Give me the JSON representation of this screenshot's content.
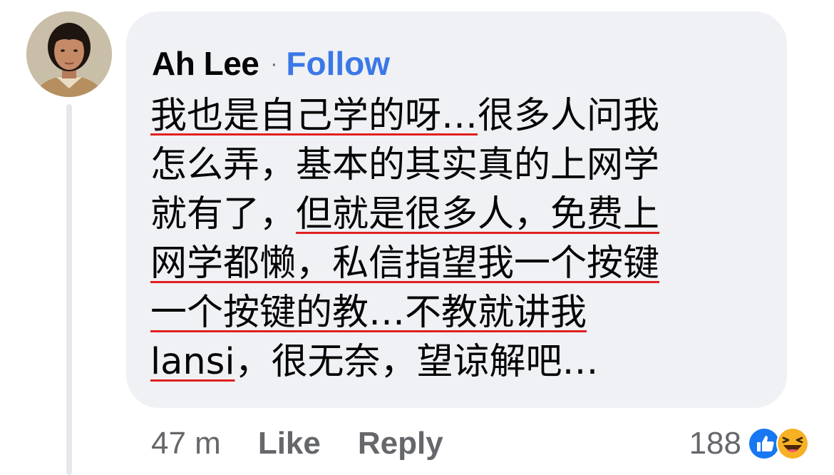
{
  "author": {
    "name": "Ah Lee",
    "separator": "·",
    "follow_label": "Follow"
  },
  "comment": {
    "lines": [
      "我也是自己学的呀…很多人问我",
      "怎么弄，基本的其实真的上网学",
      "就有了，但就是很多人，免费上",
      "网学都懒，私信指望我一个按键",
      "一个按键的教…不教就讲我",
      "lansi，很无奈，望谅解吧…"
    ],
    "segments": {
      "l1_u": "我也是自己学的呀…",
      "l1_rest": "很多人问我",
      "l3_pre": "就有了，",
      "l3_u": "但就是很多人，免费上",
      "l6_u": "lansi",
      "l6_rest": "，很无奈，望谅解吧…"
    }
  },
  "footer": {
    "time": "47 m",
    "like_label": "Like",
    "reply_label": "Reply"
  },
  "reactions": {
    "count": "188",
    "icons": [
      "like-reaction-icon",
      "haha-reaction-icon"
    ]
  },
  "colors": {
    "bubble": "#f0f1f4",
    "follow": "#3b78e7",
    "underline": "#e02020",
    "meta": "#65676b",
    "like_blue": "#1877f2",
    "haha_yellow": "#f7b125"
  }
}
